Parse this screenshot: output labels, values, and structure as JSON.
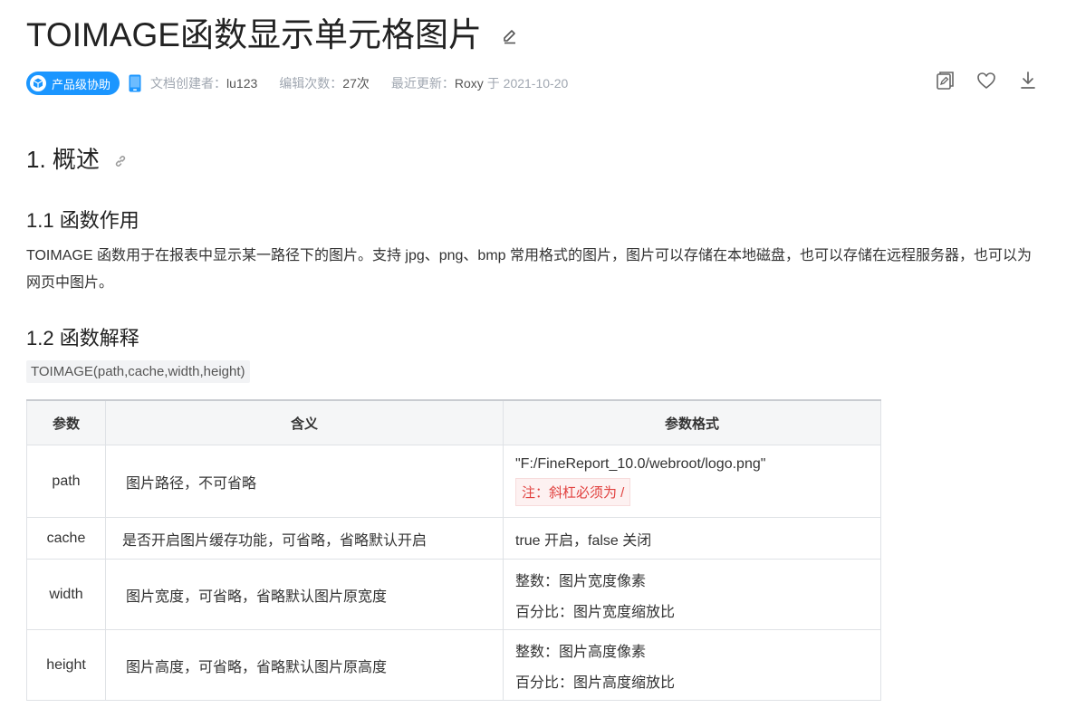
{
  "title": "TOIMAGE函数显示单元格图片",
  "meta": {
    "badge": "产品级协助",
    "creator_label": "文档创建者：",
    "creator": "lu123",
    "edits_label": "编辑次数：",
    "edits": "27次",
    "updated_label": "最近更新：",
    "updated_by": "Roxy",
    "updated_at": "于 2021-10-20"
  },
  "actions": [
    "copy-doc-icon",
    "heart-icon",
    "download-icon"
  ],
  "section1": {
    "heading": "1. 概述",
    "sub1": {
      "heading": "1.1 函数作用",
      "text": "TOIMAGE 函数用于在报表中显示某一路径下的图片。支持 jpg、png、bmp 常用格式的图片，图片可以存储在本地磁盘，也可以存储在远程服务器，也可以为网页中图片。"
    },
    "sub2": {
      "heading": "1.2 函数解释",
      "code": "TOIMAGE(path,cache,width,height)"
    }
  },
  "table": {
    "headers": [
      "参数",
      "含义",
      "参数格式"
    ],
    "rows": [
      {
        "param": "path",
        "meaning": "图片路径，不可省略",
        "format": "\"F:/FineReport_10.0/webroot/logo.png\"",
        "note": "注：斜杠必须为 /"
      },
      {
        "param": "cache",
        "meaning": "是否开启图片缓存功能，可省略，省略默认开启",
        "format": "true 开启，false 关闭"
      },
      {
        "param": "width",
        "meaning": "图片宽度，可省略，省略默认图片原宽度",
        "format": "整数：图片宽度像素",
        "format2": "百分比：图片宽度缩放比"
      },
      {
        "param": "height",
        "meaning": "图片高度，可省略，省略默认图片原高度",
        "format": "整数：图片高度像素",
        "format2": "百分比：图片高度缩放比"
      }
    ]
  },
  "colors": {
    "badge": "#1b96ff",
    "note_text": "#e1413f",
    "note_bg": "#fdf1f1"
  }
}
